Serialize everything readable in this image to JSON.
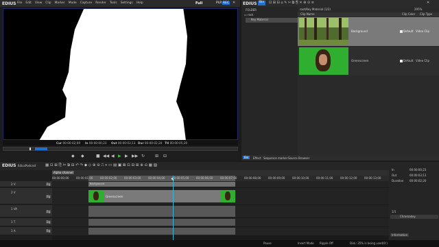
{
  "player": {
    "logo": "EDIUS",
    "menu": [
      "File",
      "Edit",
      "View",
      "Clip",
      "Marker",
      "Mode",
      "Capture",
      "Render",
      "Tools",
      "Settings",
      "Help"
    ],
    "quality": "Full",
    "mode": "PLR",
    "rec": "REC",
    "tc": {
      "cur_l": "Cur",
      "cur": "00:00:02;09",
      "in_l": "In",
      "in": "00:00:00;23",
      "out_l": "Out",
      "out": "00:00:03;13",
      "dur_l": "Dur",
      "dur": "00:00:02;20",
      "ttl_l": "Ttl",
      "ttl": "00:00:05;20"
    }
  },
  "bin": {
    "logo": "EDIUS",
    "bin_tab": "Bin",
    "folder_label": "FOLDER",
    "zoom": "295%",
    "tree_root": "root",
    "tree_child": "Key Material",
    "path": "root/Key Material (1/2)",
    "columns": {
      "clip_name": "Clip Name",
      "clip_color": "Clip Color",
      "clip_type": "Clip Type"
    },
    "clips": [
      {
        "name": "Background",
        "default": "Default",
        "type": "Video Clip"
      },
      {
        "name": "Greenscreen",
        "default": "Default",
        "type": "Video Clip"
      }
    ],
    "tabs": [
      "Bin",
      "Effect",
      "Sequence marker",
      "Source Browser"
    ]
  },
  "timeline": {
    "logo": "EDIUS",
    "project": "EdiusPodcast",
    "sequence": "Alpha channel",
    "ruler": [
      "00:00:00;00",
      "00:00:01;00",
      "00:00:02;00",
      "00:00:03;00",
      "00:00:04;00",
      "00:00:05;00",
      "00:00:06;00",
      "00:00:07;00",
      "00:00:08;00",
      "00:00:09;00",
      "00:00:10;00",
      "00:00:11;00",
      "00:00:12;00",
      "00:00:13;00"
    ],
    "tracks": [
      {
        "name": "2 V",
        "lbl": "Bg"
      },
      {
        "name": "2 V",
        "lbl": "Bg"
      },
      {
        "name": "1 VA",
        "lbl": "Bg"
      },
      {
        "name": "1 T",
        "lbl": "Bg"
      },
      {
        "name": "1 A",
        "lbl": "Bg"
      }
    ],
    "clip_v_name": "Greenscreen",
    "clip_v2_name": "Background"
  },
  "info": {
    "in_l": "In",
    "in": "00:00:00;23",
    "out_l": "Out",
    "out": "00:00:03;13",
    "dur_l": "Duration",
    "dur": "00:00:02;20",
    "count": "1/1",
    "effect": "Chromakey",
    "tab": "Information"
  },
  "status": {
    "pause": "Pause",
    "insert": "Insert Mode",
    "ripple": "Ripple Off",
    "disk": "Disk: 35% is being used(0:)"
  },
  "colors": {
    "green": "#2fae2f",
    "accent": "#1f6fd1",
    "playhead": "#35b6d8"
  }
}
